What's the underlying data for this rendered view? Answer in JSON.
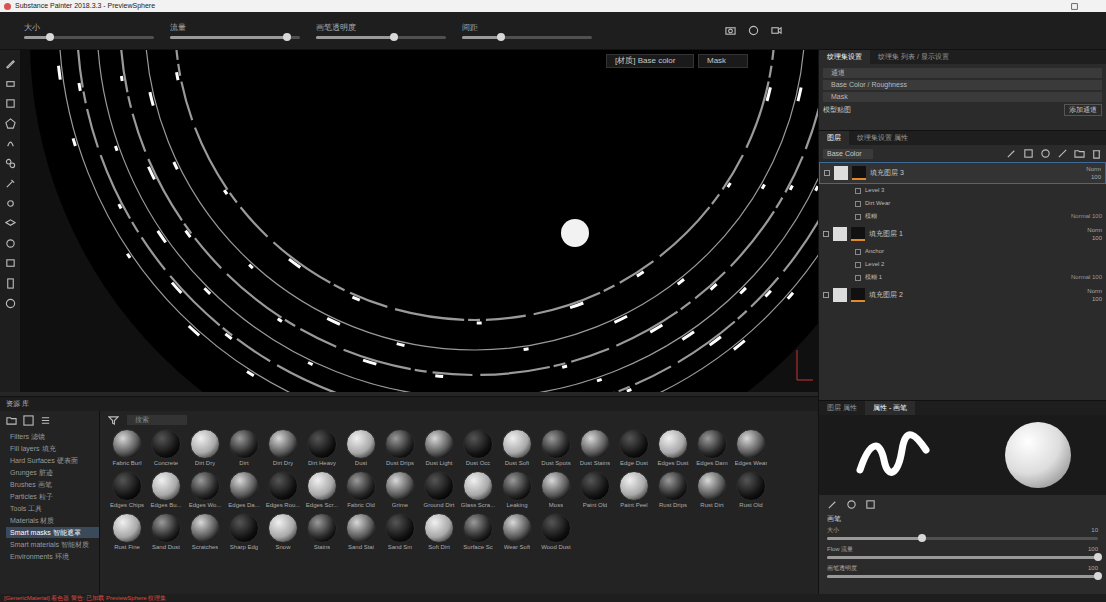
{
  "window": {
    "title": "Substance Painter 2018.3.3 - PreviewSphere"
  },
  "toolbar": {
    "sliders": [
      {
        "label": "大小",
        "level": 0.2
      },
      {
        "label": "流量",
        "level": 0.9
      },
      {
        "label": "画笔透明度",
        "level": 0.6
      },
      {
        "label": "间距",
        "level": 0.3
      }
    ]
  },
  "viewport": {
    "display": "[材质] Base color",
    "channel": "Mask"
  },
  "texture_set": {
    "tabs": [
      {
        "label": "纹理集设置",
        "selected": true
      },
      {
        "label": "纹理集 列表 / 显示设置",
        "selected": false
      }
    ],
    "rows": [
      "通道",
      "Base Color / Roughness",
      "Mask"
    ],
    "button": "添加通道",
    "section": "模型贴图"
  },
  "layers": {
    "tabs": [
      {
        "label": "图层",
        "selected": true
      },
      {
        "label": "纹理集设置 属性",
        "selected": false
      }
    ],
    "channel": "Base Color",
    "items": [
      {
        "name": "填充图层 3",
        "selected": true,
        "blend": "Norm",
        "opacity": "100",
        "effects": [
          {
            "name": "Level 3",
            "blend": "",
            "opacity": ""
          },
          {
            "name": "Dirt Wear",
            "blend": "",
            "opacity": ""
          },
          {
            "name": "模糊",
            "blend": "Normal",
            "opacity": "100"
          }
        ]
      },
      {
        "name": "填充图层 1",
        "selected": false,
        "blend": "Norm",
        "opacity": "100",
        "effects": [
          {
            "name": "Anchor",
            "blend": "",
            "opacity": ""
          },
          {
            "name": "Level 2",
            "blend": "",
            "opacity": ""
          },
          {
            "name": "模糊 1",
            "blend": "Normal",
            "opacity": "100"
          }
        ]
      },
      {
        "name": "填充图层 2",
        "selected": false,
        "blend": "Norm",
        "opacity": "100",
        "effects": []
      }
    ]
  },
  "shelf": {
    "title": "资源 库",
    "search": "搜索",
    "categories": [
      {
        "label": "Filters 滤镜",
        "selected": false
      },
      {
        "label": "Fill layers 填充",
        "selected": false
      },
      {
        "label": "Hard Surfaces 硬表面",
        "selected": false
      },
      {
        "label": "Grunges 脏迹",
        "selected": false
      },
      {
        "label": "Brushes 画笔",
        "selected": false
      },
      {
        "label": "Particles 粒子",
        "selected": false
      },
      {
        "label": "Tools 工具",
        "selected": false
      },
      {
        "label": "Materials 材质",
        "selected": false
      },
      {
        "label": "Smart masks 智能遮罩",
        "selected": true
      },
      {
        "label": "Smart materials 智能材质",
        "selected": false
      },
      {
        "label": "Environments 环境",
        "selected": false
      }
    ],
    "items": [
      "Fabric Burl",
      "Concrete",
      "Dirt Dry",
      "Dirt",
      "Dirt Dry",
      "Dirt Heavy",
      "Dust",
      "Dust Drips",
      "Dust Light",
      "Dust Occ",
      "Dust Soft",
      "Dust Spots",
      "Dust Stains",
      "Edge Dust",
      "Edges Dust",
      "Edges Dam",
      "Edges Wear",
      "Edges Chips",
      "Edges Bu...",
      "Edges Wo...",
      "Edges Da...",
      "Edges Rou...",
      "Edges Scr...",
      "Fabric Old",
      "Grime",
      "Ground Dirt",
      "Glass Scra...",
      "Leaking",
      "Moss",
      "Paint Old",
      "Paint Peel",
      "Rust Drips",
      "Rust Dirt",
      "Rust Old",
      "Rust Fine",
      "Sand Dust",
      "Scratches",
      "Sharp Edg",
      "Snow",
      "Stains",
      "Sand Stai",
      "Sand Sm",
      "Soft Dirt",
      "Surface Sc",
      "Wear Soft",
      "Wood Dust"
    ]
  },
  "properties": {
    "tabs": [
      {
        "label": "图层 属性",
        "selected": false
      },
      {
        "label": "属性 - 画笔",
        "selected": true
      }
    ],
    "section": "画笔",
    "sliders": [
      {
        "label": "大小",
        "value": "10",
        "level": 0.35
      },
      {
        "label": "Flow 流量",
        "value": "100",
        "level": 1
      },
      {
        "label": "画笔透明度",
        "value": "100",
        "level": 1
      }
    ]
  },
  "status": "[GenericMaterial] 着色器 警告: 已加载 PreviewSphere 纹理集"
}
